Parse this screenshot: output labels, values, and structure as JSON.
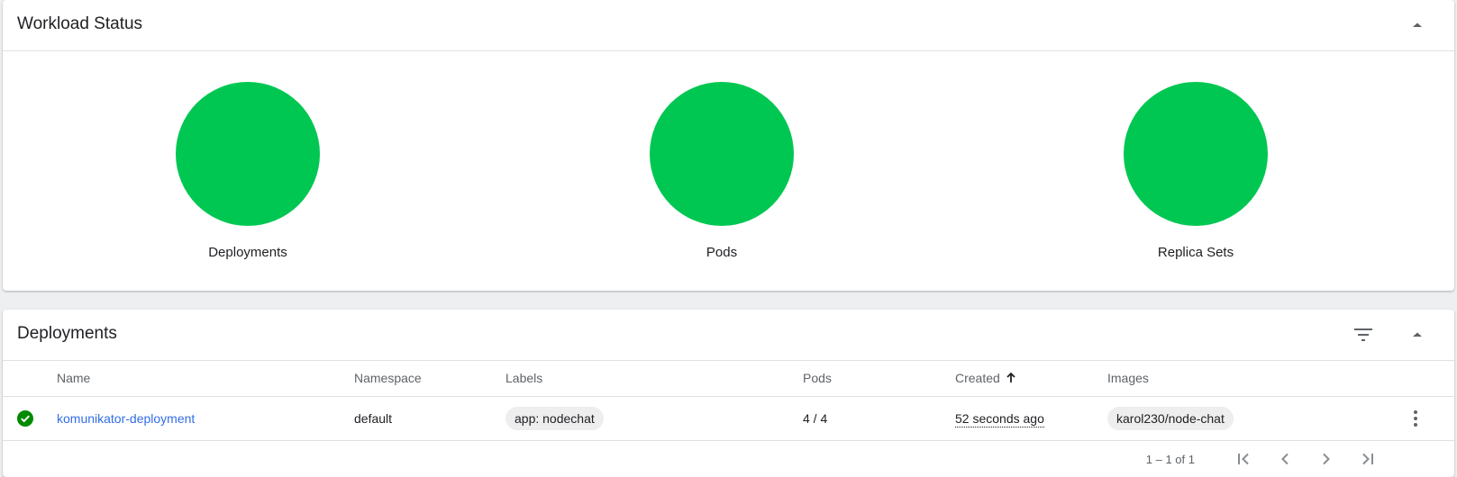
{
  "workload_status": {
    "title": "Workload Status",
    "status_color": "#00c752",
    "resources": [
      {
        "label": "Deployments",
        "status": "running",
        "running_fraction": 1.0
      },
      {
        "label": "Pods",
        "status": "running",
        "running_fraction": 1.0
      },
      {
        "label": "Replica Sets",
        "status": "running",
        "running_fraction": 1.0
      }
    ],
    "collapse_icon": "arrow-up-icon"
  },
  "deployments": {
    "title": "Deployments",
    "filter_icon": "filter-icon",
    "collapse_icon": "arrow-up-icon",
    "columns": {
      "name": "Name",
      "namespace": "Namespace",
      "labels": "Labels",
      "pods": "Pods",
      "created": "Created",
      "images": "Images"
    },
    "sort": {
      "column": "created",
      "direction": "ascending",
      "icon": "arrow-up-icon"
    },
    "rows": [
      {
        "status_icon": "check-circle-icon",
        "status_color": "#008a00",
        "name": "komunikator-deployment",
        "namespace": "default",
        "labels": [
          "app: nodechat"
        ],
        "pods": "4 / 4",
        "created": "52 seconds ago",
        "images": [
          "karol230/node-chat"
        ]
      }
    ],
    "paginator": {
      "range_label": "1 – 1 of 1",
      "first_icon": "first-page-icon",
      "prev_icon": "chevron-left-icon",
      "next_icon": "chevron-right-icon",
      "last_icon": "last-page-icon"
    },
    "link_color": "#326de6"
  }
}
